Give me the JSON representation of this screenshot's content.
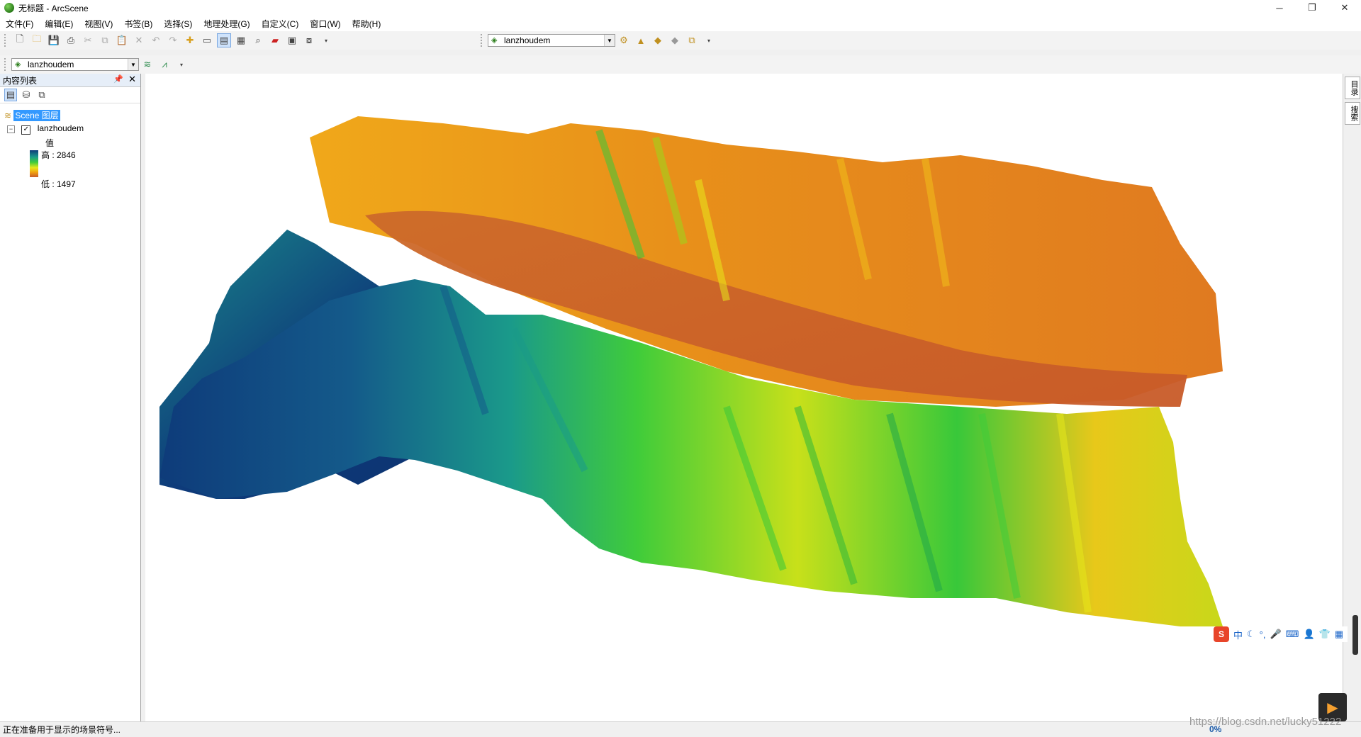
{
  "window": {
    "title": "无标题 - ArcScene"
  },
  "menu": [
    "文件(F)",
    "编辑(E)",
    "视图(V)",
    "书签(B)",
    "选择(S)",
    "地理处理(G)",
    "自定义(C)",
    "窗口(W)",
    "帮助(H)"
  ],
  "toolbar": {
    "layer_combo_top": "lanzhoudem",
    "layer_combo_left": "lanzhoudem"
  },
  "toc": {
    "title": "内容列表",
    "scene_label": "Scene 图层",
    "layer_name": "lanzhoudem",
    "layer_checked": true,
    "legend_heading": "值",
    "legend_high": "高 : 2846",
    "legend_low": "低 : 1497"
  },
  "right_tabs": [
    "目录",
    "搜索"
  ],
  "status": {
    "message": "正在准备用于显示的场景符号...",
    "progress": "0%"
  },
  "ime": {
    "lang": "中"
  },
  "watermark": "https://blog.csdn.net/lucky51222",
  "colors": {
    "high": "#0e3b7a",
    "mid_green": "#40cc3a",
    "mid_yellow": "#e8e81a",
    "low": "#c85a28"
  }
}
